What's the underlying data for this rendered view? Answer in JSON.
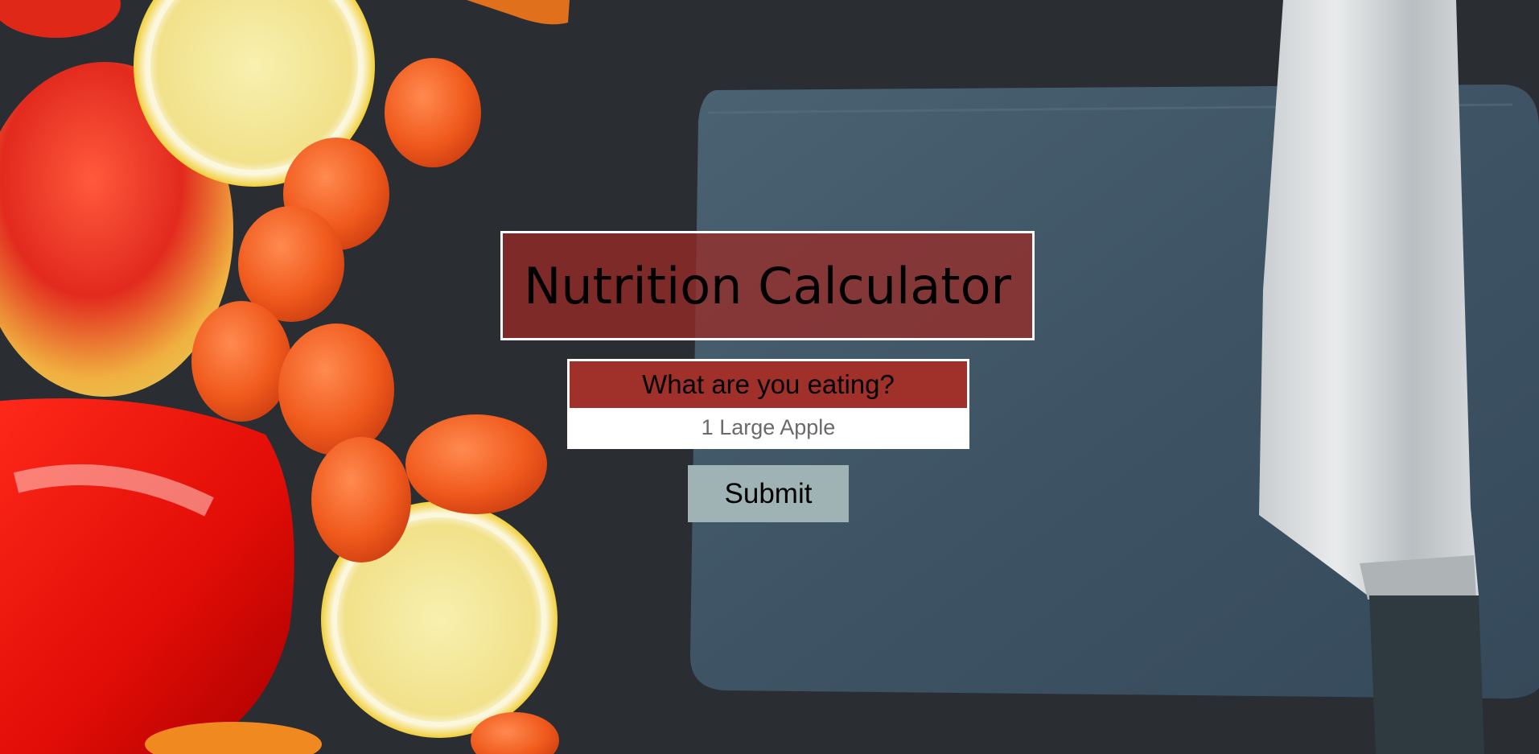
{
  "page": {
    "title": "Nutrition Calculator"
  },
  "form": {
    "label": "What are you eating?",
    "input_placeholder": "1 Large Apple",
    "input_value": "",
    "submit_label": "Submit"
  },
  "colors": {
    "title_bg": "#9e2a24",
    "label_bg": "#a0302a",
    "button_bg": "#9fb3b5",
    "background": "#2b2f34",
    "slate": "#3f5666"
  }
}
